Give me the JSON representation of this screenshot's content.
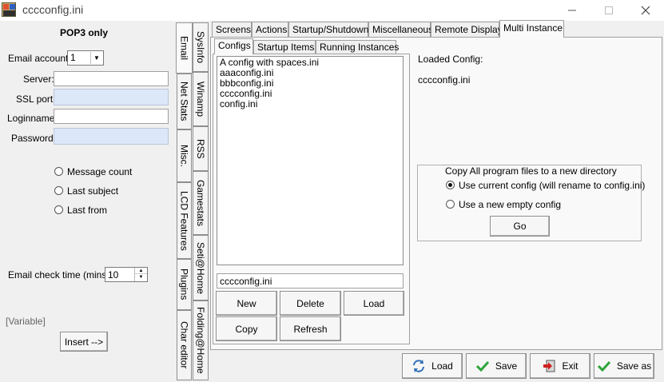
{
  "window": {
    "title": "cccconfig.ini"
  },
  "left": {
    "heading": "POP3 only",
    "email_account_label": "Email account:",
    "email_account_value": "1",
    "server_label": "Server:",
    "server_value": "",
    "ssl_port_label": "SSL port:",
    "ssl_port_value": "",
    "loginname_label": "Loginname:",
    "loginname_value": "",
    "password_label": "Password:",
    "password_value": "",
    "radios": [
      {
        "label": "Message count",
        "checked": false
      },
      {
        "label": "Last subject",
        "checked": false
      },
      {
        "label": "Last from",
        "checked": false
      }
    ],
    "check_time_label": "Email check time (mins):",
    "check_time_value": "10",
    "variable_label": "[Variable]",
    "insert_label": "Insert -->"
  },
  "vertical_tabs": {
    "col1": [
      "Email",
      "Net Stats",
      "Misc.",
      "LCD Features",
      "Plugins",
      "Char editor"
    ],
    "col2": [
      "SysInfo",
      "Winamp",
      "RSS",
      "Gamestats",
      "Seti@Home",
      "Folding@Home"
    ],
    "active": "Email"
  },
  "top_tabs": {
    "items": [
      "Screens",
      "Actions",
      "Startup/Shutdown",
      "Miscellaneous",
      "Remote Display",
      "Multi Instance"
    ],
    "active": "Multi Instance"
  },
  "sub_tabs": {
    "items": [
      "Configs",
      "Startup Items",
      "Running Instances"
    ],
    "active": "Configs"
  },
  "configs": {
    "list": [
      "A config with spaces.ini",
      "aaaconfig.ini",
      "bbbconfig.ini",
      "cccconfig.ini",
      "config.ini"
    ],
    "name_value": "cccconfig.ini",
    "buttons": {
      "new": "New",
      "delete": "Delete",
      "load": "Load",
      "copy": "Copy",
      "refresh": "Refresh"
    }
  },
  "loaded": {
    "label": "Loaded Config:",
    "value": "cccconfig.ini"
  },
  "copy_group": {
    "title": "Copy All program files to a new directory",
    "option1": "Use current config (will rename to config.ini)",
    "option2": "Use a new empty config",
    "selected": "option1",
    "go_label": "Go"
  },
  "bottom_buttons": {
    "load": "Load",
    "save": "Save",
    "exit": "Exit",
    "save_as": "Save as"
  },
  "colors": {
    "check_green": "#2ea43a",
    "exit_red": "#d02020",
    "load_blue": "#2f6fb5"
  }
}
